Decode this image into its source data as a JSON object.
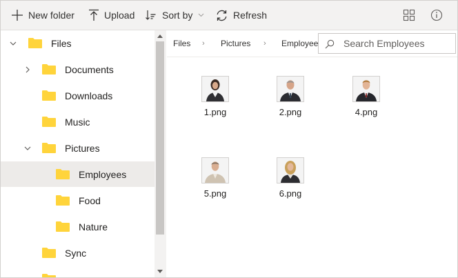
{
  "toolbar": {
    "new_folder": "New folder",
    "upload": "Upload",
    "sort_by": "Sort by",
    "refresh": "Refresh"
  },
  "tree": [
    {
      "label": "Files",
      "icon": "folder-icon",
      "expanded": true
    },
    {
      "label": "Documents",
      "icon": "folder-icon",
      "expanded": false
    },
    {
      "label": "Downloads",
      "icon": "folder-icon"
    },
    {
      "label": "Music",
      "icon": "folder-icon"
    },
    {
      "label": "Pictures",
      "icon": "folder-icon",
      "expanded": true
    },
    {
      "label": "Employees",
      "icon": "folder-icon",
      "selected": true
    },
    {
      "label": "Food",
      "icon": "folder-icon"
    },
    {
      "label": "Nature",
      "icon": "folder-icon"
    },
    {
      "label": "Sync",
      "icon": "folder-icon"
    }
  ],
  "breadcrumb": [
    "Files",
    "Pictures",
    "Employees"
  ],
  "search": {
    "placeholder": "Search Employees"
  },
  "files": [
    {
      "name": "1.png"
    },
    {
      "name": "2.png"
    },
    {
      "name": "4.png"
    },
    {
      "name": "5.png"
    },
    {
      "name": "6.png"
    }
  ],
  "colors": {
    "folder": "#ffd43b",
    "toolbar_bg": "#f3f2f1",
    "selected_bg": "#edebe9"
  }
}
